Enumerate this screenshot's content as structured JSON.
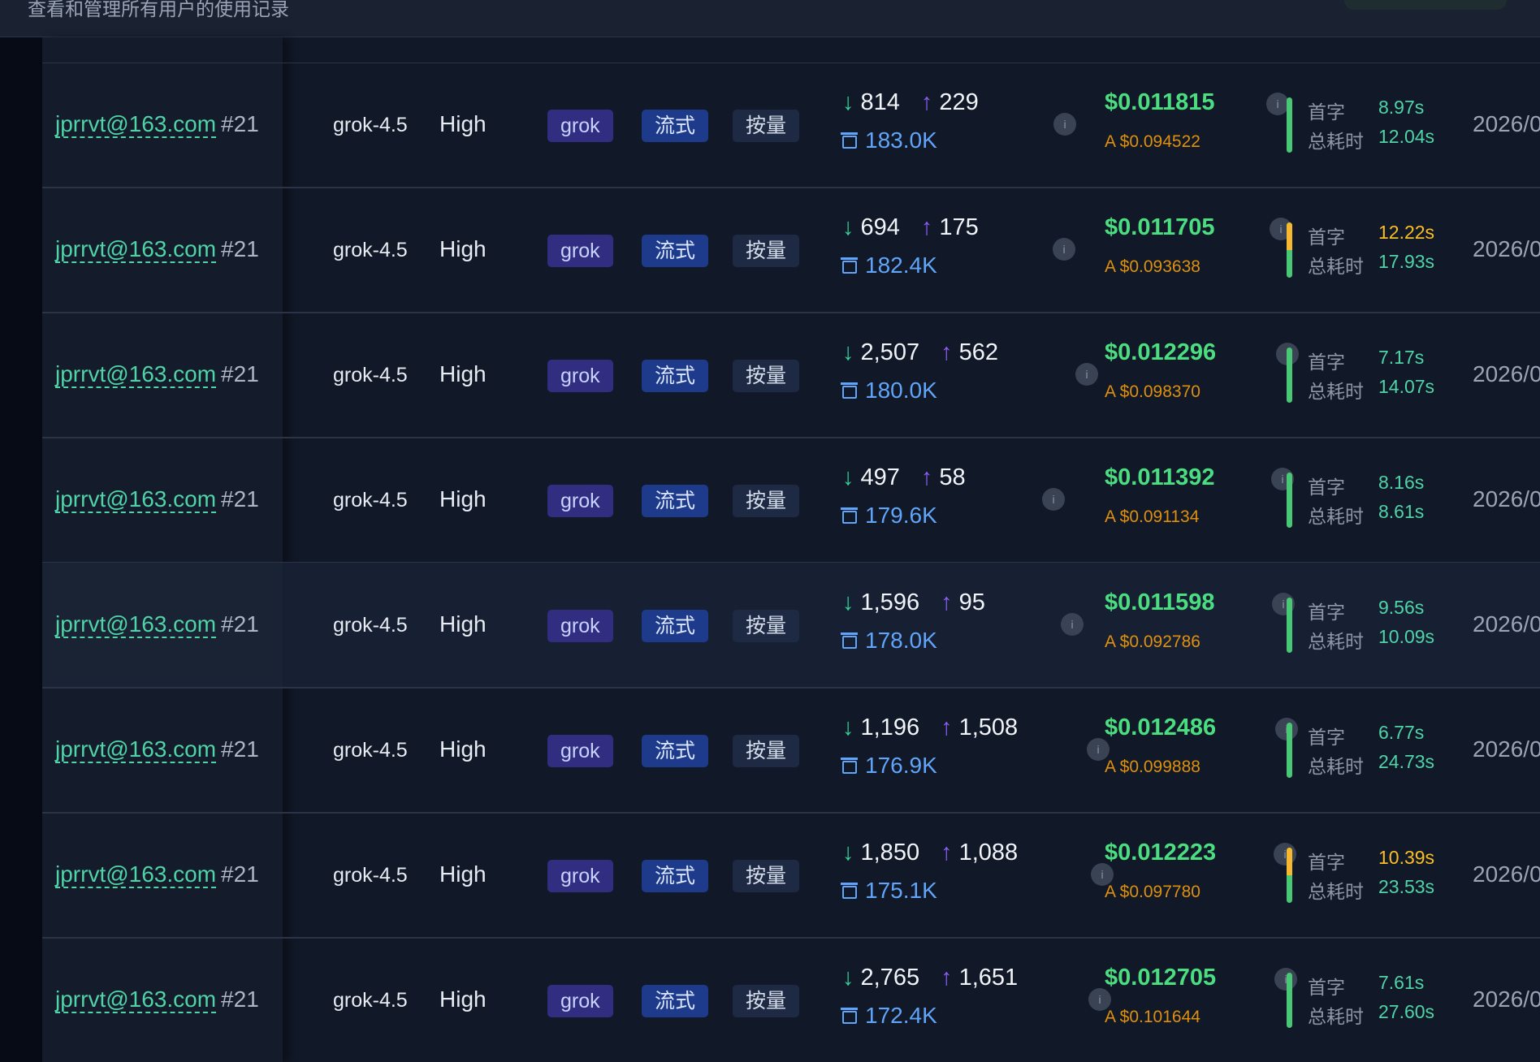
{
  "header": {
    "subtitle": "查看和管理所有用户的使用记录"
  },
  "rows": [
    {
      "email": "jprrvt@163.com",
      "uid": "#21",
      "model": "grok-4.5",
      "effort": "High",
      "group": "grok",
      "stream": "流式",
      "billing": "按量",
      "tok_in": "814",
      "tok_out": "229",
      "cache": "183.0K",
      "cost": "$0.011815",
      "cost_a": "A $0.094522",
      "first_label": "首字",
      "first": "8.97s",
      "total_label": "总耗时",
      "total": "12.04s",
      "first_slow": false,
      "date": "2026/0"
    },
    {
      "email": "jprrvt@163.com",
      "uid": "#21",
      "model": "grok-4.5",
      "effort": "High",
      "group": "grok",
      "stream": "流式",
      "billing": "按量",
      "tok_in": "694",
      "tok_out": "175",
      "cache": "182.4K",
      "cost": "$0.011705",
      "cost_a": "A $0.093638",
      "first_label": "首字",
      "first": "12.22s",
      "total_label": "总耗时",
      "total": "17.93s",
      "first_slow": true,
      "date": "2026/0"
    },
    {
      "email": "jprrvt@163.com",
      "uid": "#21",
      "model": "grok-4.5",
      "effort": "High",
      "group": "grok",
      "stream": "流式",
      "billing": "按量",
      "tok_in": "2,507",
      "tok_out": "562",
      "cache": "180.0K",
      "cost": "$0.012296",
      "cost_a": "A $0.098370",
      "first_label": "首字",
      "first": "7.17s",
      "total_label": "总耗时",
      "total": "14.07s",
      "first_slow": false,
      "date": "2026/0"
    },
    {
      "email": "jprrvt@163.com",
      "uid": "#21",
      "model": "grok-4.5",
      "effort": "High",
      "group": "grok",
      "stream": "流式",
      "billing": "按量",
      "tok_in": "497",
      "tok_out": "58",
      "cache": "179.6K",
      "cost": "$0.011392",
      "cost_a": "A $0.091134",
      "first_label": "首字",
      "first": "8.16s",
      "total_label": "总耗时",
      "total": "8.61s",
      "first_slow": false,
      "date": "2026/0"
    },
    {
      "email": "jprrvt@163.com",
      "uid": "#21",
      "model": "grok-4.5",
      "effort": "High",
      "group": "grok",
      "stream": "流式",
      "billing": "按量",
      "tok_in": "1,596",
      "tok_out": "95",
      "cache": "178.0K",
      "cost": "$0.011598",
      "cost_a": "A $0.092786",
      "first_label": "首字",
      "first": "9.56s",
      "total_label": "总耗时",
      "total": "10.09s",
      "first_slow": false,
      "date": "2026/0"
    },
    {
      "email": "jprrvt@163.com",
      "uid": "#21",
      "model": "grok-4.5",
      "effort": "High",
      "group": "grok",
      "stream": "流式",
      "billing": "按量",
      "tok_in": "1,196",
      "tok_out": "1,508",
      "cache": "176.9K",
      "cost": "$0.012486",
      "cost_a": "A $0.099888",
      "first_label": "首字",
      "first": "6.77s",
      "total_label": "总耗时",
      "total": "24.73s",
      "first_slow": false,
      "date": "2026/0"
    },
    {
      "email": "jprrvt@163.com",
      "uid": "#21",
      "model": "grok-4.5",
      "effort": "High",
      "group": "grok",
      "stream": "流式",
      "billing": "按量",
      "tok_in": "1,850",
      "tok_out": "1,088",
      "cache": "175.1K",
      "cost": "$0.012223",
      "cost_a": "A $0.097780",
      "first_label": "首字",
      "first": "10.39s",
      "total_label": "总耗时",
      "total": "23.53s",
      "first_slow": true,
      "date": "2026/0"
    },
    {
      "email": "jprrvt@163.com",
      "uid": "#21",
      "model": "grok-4.5",
      "effort": "High",
      "group": "grok",
      "stream": "流式",
      "billing": "按量",
      "tok_in": "2,765",
      "tok_out": "1,651",
      "cache": "172.4K",
      "cost": "$0.012705",
      "cost_a": "A $0.101644",
      "first_label": "首字",
      "first": "7.61s",
      "total_label": "总耗时",
      "total": "27.60s",
      "first_slow": false,
      "date": "2026/0"
    }
  ],
  "hover_row": 4
}
